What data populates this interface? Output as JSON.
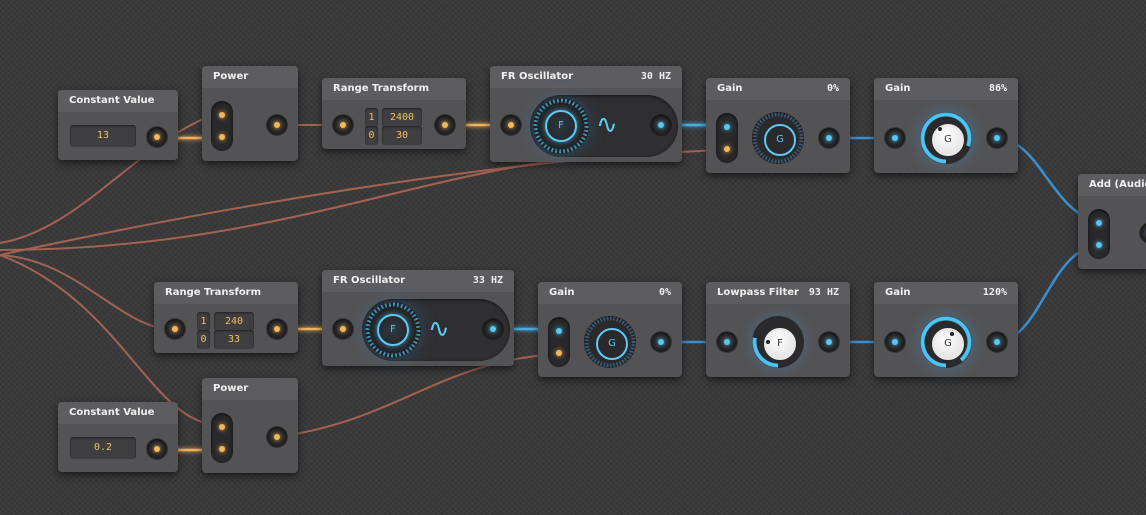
{
  "colors": {
    "orange_wire": "#b56a55",
    "orange_port": "#f3b65a",
    "blue_port": "#57c7f2",
    "node_bg": "#535355"
  },
  "nodes": {
    "constant1": {
      "title": "Constant Value",
      "value": "13"
    },
    "power1": {
      "title": "Power"
    },
    "range1": {
      "title": "Range Transform",
      "a": "1",
      "b": "0",
      "max": "2400",
      "min": "30"
    },
    "osc1": {
      "title": "FR Oscillator",
      "freq": "30 HZ",
      "dial": "F",
      "wave_icon": "sine-wave-icon"
    },
    "gain1": {
      "title": "Gain",
      "value": "0%",
      "knob": "G"
    },
    "gain2": {
      "title": "Gain",
      "value": "86%",
      "knob": "G"
    },
    "add": {
      "title": "Add (Audio/"
    },
    "range2": {
      "title": "Range Transform",
      "a": "1",
      "b": "0",
      "max": "240",
      "min": "33"
    },
    "osc2": {
      "title": "FR Oscillator",
      "freq": "33 HZ",
      "dial": "F",
      "wave_icon": "sine-wave-icon"
    },
    "gain3": {
      "title": "Gain",
      "value": "0%",
      "knob": "G"
    },
    "lowpass": {
      "title": "Lowpass Filter",
      "freq": "93 HZ",
      "knob": "F"
    },
    "gain4": {
      "title": "Gain",
      "value": "120%",
      "knob": "G"
    },
    "power2": {
      "title": "Power"
    },
    "constant2": {
      "title": "Constant Value",
      "value": "0.2"
    }
  }
}
